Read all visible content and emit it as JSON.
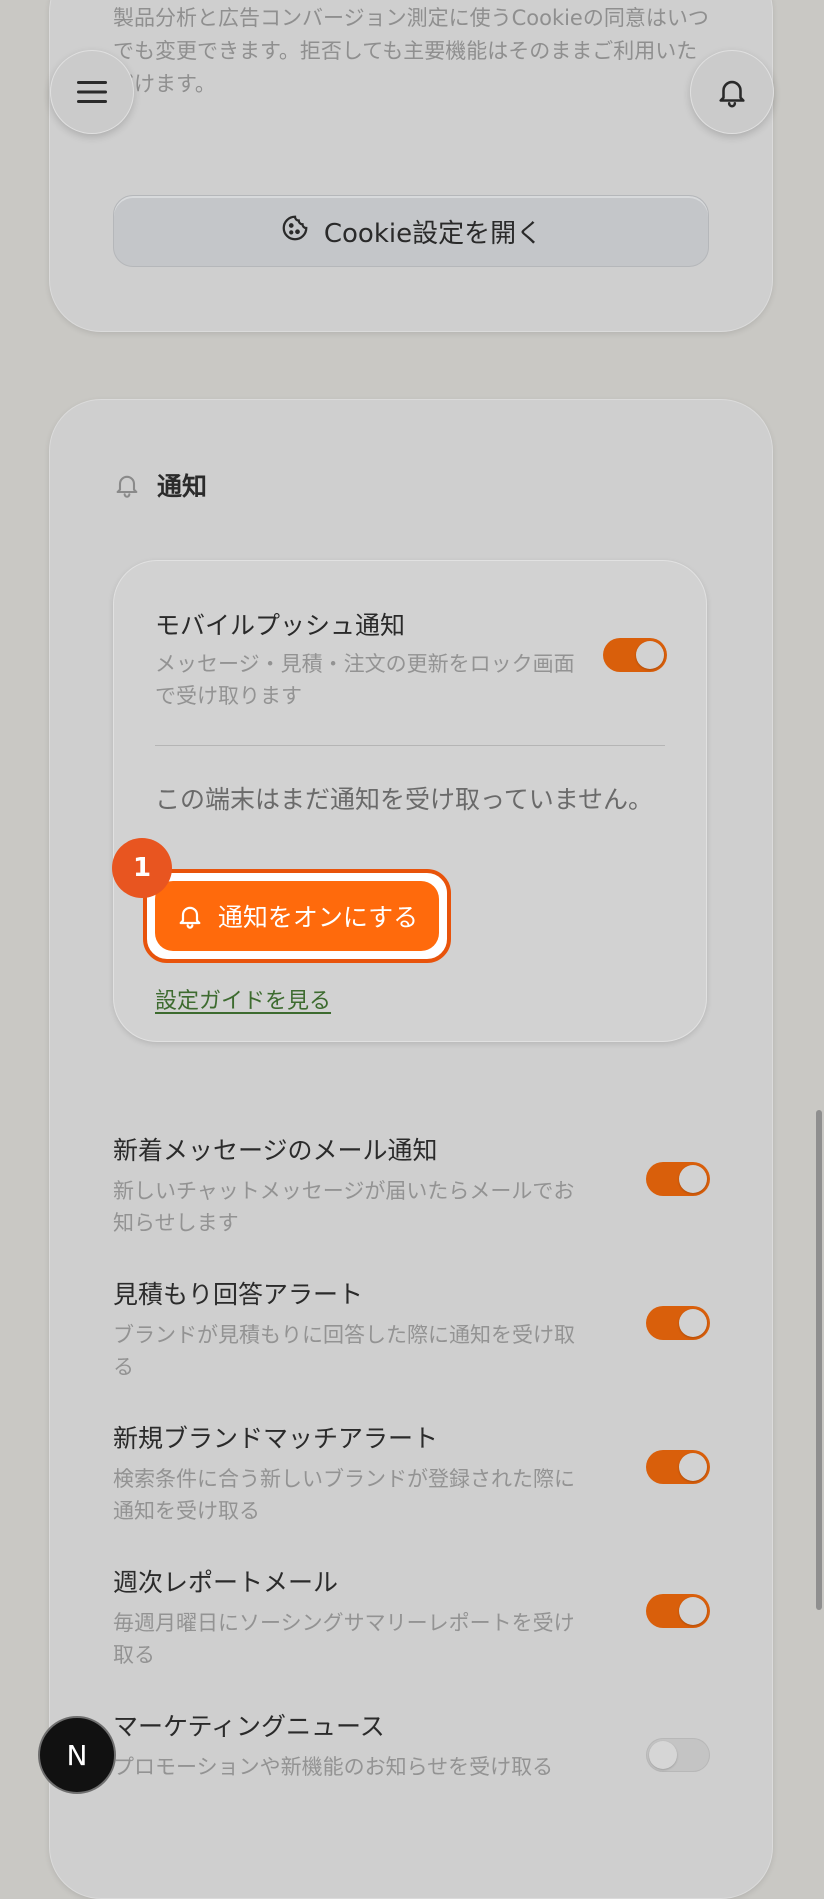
{
  "cookie": {
    "description": "製品分析と広告コンバージョン測定に使うCookieの同意はいつでも変更できます。拒否しても主要機能はそのままご利用いただけます。",
    "button_label": "Cookie設定を開く"
  },
  "notifications": {
    "section_title": "通知",
    "push": {
      "title": "モバイルプッシュ通知",
      "description": "メッセージ・見積・注文の更新をロック画面で受け取ります",
      "status": "この端末はまだ通知を受け取っていません。",
      "enable_button": "通知をオンにする",
      "guide_link": "設定ガイドを見る",
      "badge": "1",
      "enabled": true
    },
    "items": [
      {
        "title": "新着メッセージのメール通知",
        "description": "新しいチャットメッセージが届いたらメールでお知らせします",
        "enabled": true
      },
      {
        "title": "見積もり回答アラート",
        "description": "ブランドが見積もりに回答した際に通知を受け取る",
        "enabled": true
      },
      {
        "title": "新規ブランドマッチアラート",
        "description": "検索条件に合う新しいブランドが登録された際に通知を受け取る",
        "enabled": true
      },
      {
        "title": "週次レポートメール",
        "description": "毎週月曜日にソーシングサマリーレポートを受け取る",
        "enabled": true
      },
      {
        "title": "マーケティングニュース",
        "description": "プロモーションや新機能のお知らせを受け取る",
        "enabled": false
      }
    ]
  },
  "floating": {
    "n_label": "N"
  },
  "icons": [
    "menu-icon",
    "bell-icon",
    "cookie-icon"
  ],
  "colors": {
    "accent": "#ff6a0c",
    "toggle_on": "#d95f0b",
    "link": "#3d6b2f"
  }
}
